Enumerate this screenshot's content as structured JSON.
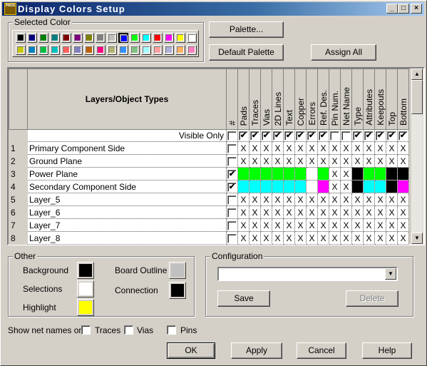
{
  "window": {
    "title": "Display Colors Setup",
    "icon_text": "PADS"
  },
  "selected_color": {
    "label": "Selected Color",
    "selected_index": 9,
    "palette": [
      "#000000",
      "#000080",
      "#008000",
      "#008080",
      "#800000",
      "#800080",
      "#808000",
      "#808080",
      "#c0c0c0",
      "#0000ff",
      "#00ff00",
      "#00ffff",
      "#ff0000",
      "#ff00ff",
      "#ffff00",
      "#ffffff",
      "#c8c800",
      "#0080c0",
      "#00c040",
      "#00c0c0",
      "#ff6060",
      "#8080c0",
      "#c06000",
      "#ff0080",
      "#b0b070",
      "#3090ff",
      "#80c080",
      "#a0ffff",
      "#ffa0a0",
      "#b0b0d8",
      "#ffb060",
      "#ff80c0"
    ]
  },
  "buttons": {
    "palette": "Palette...",
    "default_palette": "Default Palette",
    "assign_all": "Assign All",
    "save": "Save",
    "delete": "Delete",
    "ok": "OK",
    "apply": "Apply",
    "cancel": "Cancel",
    "help": "Help"
  },
  "grid": {
    "header": "Layers/Object Types",
    "hash": "#",
    "visible_only": "Visible Only",
    "columns": [
      "Pads",
      "Traces",
      "Vias",
      "2D Lines",
      "Text",
      "Copper",
      "Errors",
      "Ref. Des.",
      "Pin Num.",
      "Net Name",
      "Type",
      "Attributes",
      "Keepouts",
      "Top",
      "Bottom"
    ],
    "visible_hash": false,
    "visible": [
      true,
      true,
      true,
      true,
      true,
      true,
      true,
      true,
      false,
      false,
      true,
      true,
      true,
      true,
      true
    ],
    "rows": [
      {
        "num": "1",
        "name": "Primary Component Side",
        "checked": false,
        "cells": [
          "X",
          "X",
          "X",
          "X",
          "X",
          "X",
          "X",
          "X",
          "X",
          "X",
          "X",
          "X",
          "X",
          "X",
          "X"
        ]
      },
      {
        "num": "2",
        "name": "Ground Plane",
        "checked": false,
        "cells": [
          "X",
          "X",
          "X",
          "X",
          "X",
          "X",
          "X",
          "X",
          "X",
          "X",
          "X",
          "X",
          "X",
          "X",
          "X"
        ]
      },
      {
        "num": "3",
        "name": "Power Plane",
        "checked": true,
        "cells": [
          "#00ff00",
          "#00ff00",
          "#00ff00",
          "#00ff00",
          "#00ff00",
          "#00ff00",
          "#ffffff",
          "#00ff00",
          "X",
          "X",
          "#000000",
          "#00ff00",
          "#00ff00",
          "#000000",
          "#000000"
        ]
      },
      {
        "num": "4",
        "name": "Secondary Component Side",
        "checked": true,
        "cells": [
          "#00ffff",
          "#00ffff",
          "#00ffff",
          "#00ffff",
          "#00ffff",
          "#00ffff",
          "#ffffff",
          "#ff00ff",
          "X",
          "X",
          "#000000",
          "#00ffff",
          "#00ffff",
          "#000000",
          "#ff00ff"
        ]
      },
      {
        "num": "5",
        "name": "Layer_5",
        "checked": false,
        "cells": [
          "X",
          "X",
          "X",
          "X",
          "X",
          "X",
          "X",
          "X",
          "X",
          "X",
          "X",
          "X",
          "X",
          "X",
          "X"
        ]
      },
      {
        "num": "6",
        "name": "Layer_6",
        "checked": false,
        "cells": [
          "X",
          "X",
          "X",
          "X",
          "X",
          "X",
          "X",
          "X",
          "X",
          "X",
          "X",
          "X",
          "X",
          "X",
          "X"
        ]
      },
      {
        "num": "7",
        "name": "Layer_7",
        "checked": false,
        "cells": [
          "X",
          "X",
          "X",
          "X",
          "X",
          "X",
          "X",
          "X",
          "X",
          "X",
          "X",
          "X",
          "X",
          "X",
          "X"
        ]
      },
      {
        "num": "8",
        "name": "Layer_8",
        "checked": false,
        "cells": [
          "X",
          "X",
          "X",
          "X",
          "X",
          "X",
          "X",
          "X",
          "X",
          "X",
          "X",
          "X",
          "X",
          "X",
          "X"
        ]
      }
    ]
  },
  "other": {
    "label": "Other",
    "background": "Background",
    "background_color": "#000000",
    "selections": "Selections",
    "selections_color": "#ffffff",
    "highlight": "Highlight",
    "highlight_color": "#ffff00",
    "board_outline": "Board Outline",
    "board_outline_color": "#c0c0c0",
    "connection": "Connection",
    "connection_color": "#000000"
  },
  "configuration": {
    "label": "Configuration",
    "value": ""
  },
  "net_names": {
    "label": "Show net names on",
    "traces": "Traces",
    "vias": "Vias",
    "pins": "Pins",
    "traces_checked": false,
    "vias_checked": false,
    "pins_checked": false
  }
}
